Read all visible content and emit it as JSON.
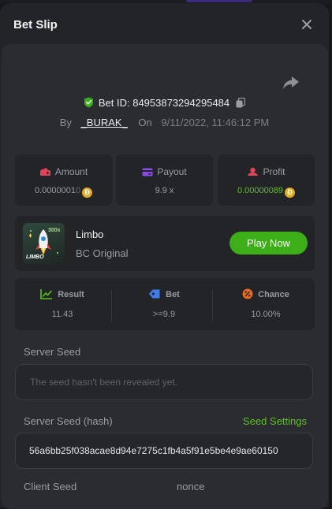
{
  "modal": {
    "title": "Bet Slip"
  },
  "bet": {
    "id_label": "Bet ID:",
    "id_value": "84953873294295484",
    "by_label": "By",
    "username": "_BURAK_",
    "on_label": "On",
    "date": "9/11/2022, 11:46:12 PM"
  },
  "stats": {
    "amount": {
      "label": "Amount",
      "value": "0.0000001",
      "value_faded": "0"
    },
    "payout": {
      "label": "Payout",
      "value": "9.9 x"
    },
    "profit": {
      "label": "Profit",
      "value": "0.00000089"
    }
  },
  "game": {
    "name": "Limbo",
    "provider": "BC Original",
    "thumb_badge": "LIMBO",
    "thumb_multiplier": "300x",
    "play_label": "Play Now"
  },
  "result": {
    "result": {
      "label": "Result",
      "value": "11.43"
    },
    "bet": {
      "label": "Bet",
      "value": ">=9.9"
    },
    "chance": {
      "label": "Chance",
      "value": "10.00%"
    }
  },
  "seeds": {
    "server_seed_label": "Server Seed",
    "server_seed_placeholder": "The seed hasn't been revealed yet.",
    "server_hash_label": "Server Seed (hash)",
    "seed_settings_label": "Seed Settings",
    "server_hash_value": "56a6bb25f038acae8d94e7275c1fb4a5f91e5be4e9ae60150",
    "client_seed_label": "Client Seed",
    "nonce_label": "nonce"
  },
  "colors": {
    "accent_green": "#3cae17",
    "profit_green": "#5cc21b",
    "coin": "#e2ad24"
  },
  "icons": {
    "close": "close-icon",
    "share": "share-icon",
    "shield": "shield-check-icon",
    "copy": "copy-icon",
    "amount": "amount-icon",
    "payout": "payout-icon",
    "profit": "profit-icon",
    "result": "result-icon",
    "bet": "bet-tag-icon",
    "chance": "chance-icon"
  }
}
